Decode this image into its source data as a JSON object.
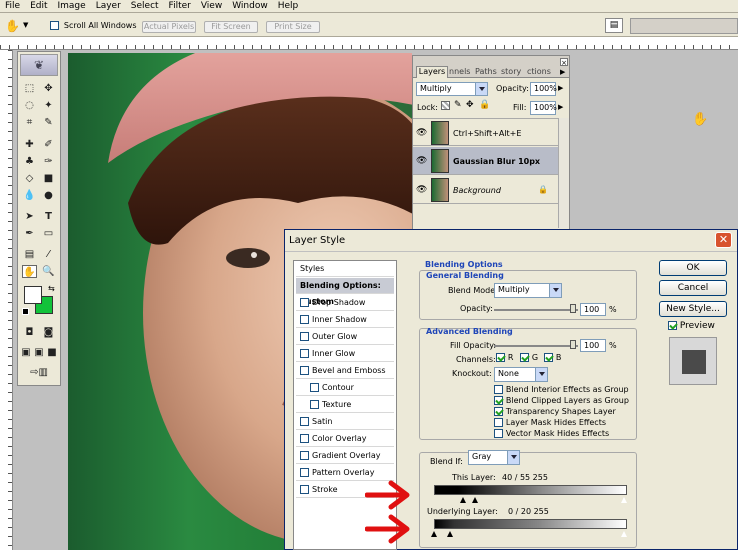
{
  "menu": [
    "File",
    "Edit",
    "Image",
    "Layer",
    "Select",
    "Filter",
    "View",
    "Window",
    "Help"
  ],
  "options_bar": {
    "scroll_all_label": "Scroll All Windows",
    "actual_pixels": "Actual Pixels",
    "fit_screen": "Fit Screen",
    "print_size": "Print Size"
  },
  "layers_panel": {
    "tabs": [
      "Layers",
      "nnels",
      "Paths",
      "story",
      "ctions"
    ],
    "blend_mode": "Multiply",
    "opacity_label": "Opacity:",
    "opacity_value": "100%",
    "lock_label": "Lock:",
    "fill_label": "Fill:",
    "fill_value": "100%",
    "layers": [
      {
        "name": "Ctrl+Shift+Alt+E",
        "selected": false
      },
      {
        "name": "Gaussian Blur 10px",
        "selected": true
      },
      {
        "name": "Background",
        "selected": false
      }
    ]
  },
  "dialog": {
    "title": "Layer Style",
    "styles_header": "Styles",
    "styles": [
      {
        "label": "Blending Options: Custom",
        "checkbox": false,
        "active": true
      },
      {
        "label": "Drop Shadow",
        "checkbox": true
      },
      {
        "label": "Inner Shadow",
        "checkbox": true
      },
      {
        "label": "Outer Glow",
        "checkbox": true
      },
      {
        "label": "Inner Glow",
        "checkbox": true
      },
      {
        "label": "Bevel and Emboss",
        "checkbox": true
      },
      {
        "label": "Contour",
        "checkbox": true,
        "indent": true
      },
      {
        "label": "Texture",
        "checkbox": true,
        "indent": true
      },
      {
        "label": "Satin",
        "checkbox": true
      },
      {
        "label": "Color Overlay",
        "checkbox": true
      },
      {
        "label": "Gradient Overlay",
        "checkbox": true
      },
      {
        "label": "Pattern Overlay",
        "checkbox": true
      },
      {
        "label": "Stroke",
        "checkbox": true
      }
    ],
    "blending_options_title": "Blending Options",
    "general_blending_title": "General Blending",
    "blend_mode_label": "Blend Mode:",
    "blend_mode_value": "Multiply",
    "opacity_label": "Opacity:",
    "opacity_value": "100",
    "percent": "%",
    "advanced_title": "Advanced Blending",
    "fill_opacity_label": "Fill Opacity:",
    "fill_opacity_value": "100",
    "channels_label": "Channels:",
    "channel_r": "R",
    "channel_g": "G",
    "channel_b": "B",
    "knockout_label": "Knockout:",
    "knockout_value": "None",
    "adv_checks": [
      {
        "label": "Blend Interior Effects as Group",
        "checked": false
      },
      {
        "label": "Blend Clipped Layers as Group",
        "checked": true
      },
      {
        "label": "Transparency Shapes Layer",
        "checked": true
      },
      {
        "label": "Layer Mask Hides Effects",
        "checked": false
      },
      {
        "label": "Vector Mask Hides Effects",
        "checked": false
      }
    ],
    "blend_if_label": "Blend If:",
    "blend_if_value": "Gray",
    "this_layer_label": "This Layer:",
    "this_layer_values": "40  /  55        255",
    "underlying_label": "Underlying Layer:",
    "underlying_values": "0   /  20        255",
    "ok": "OK",
    "cancel": "Cancel",
    "new_style": "New Style...",
    "preview": "Preview"
  },
  "colors": {
    "foreground": "#ffffff",
    "background": "#12c23a",
    "arrow": "#e01010",
    "selection": "#b8bcc8"
  }
}
